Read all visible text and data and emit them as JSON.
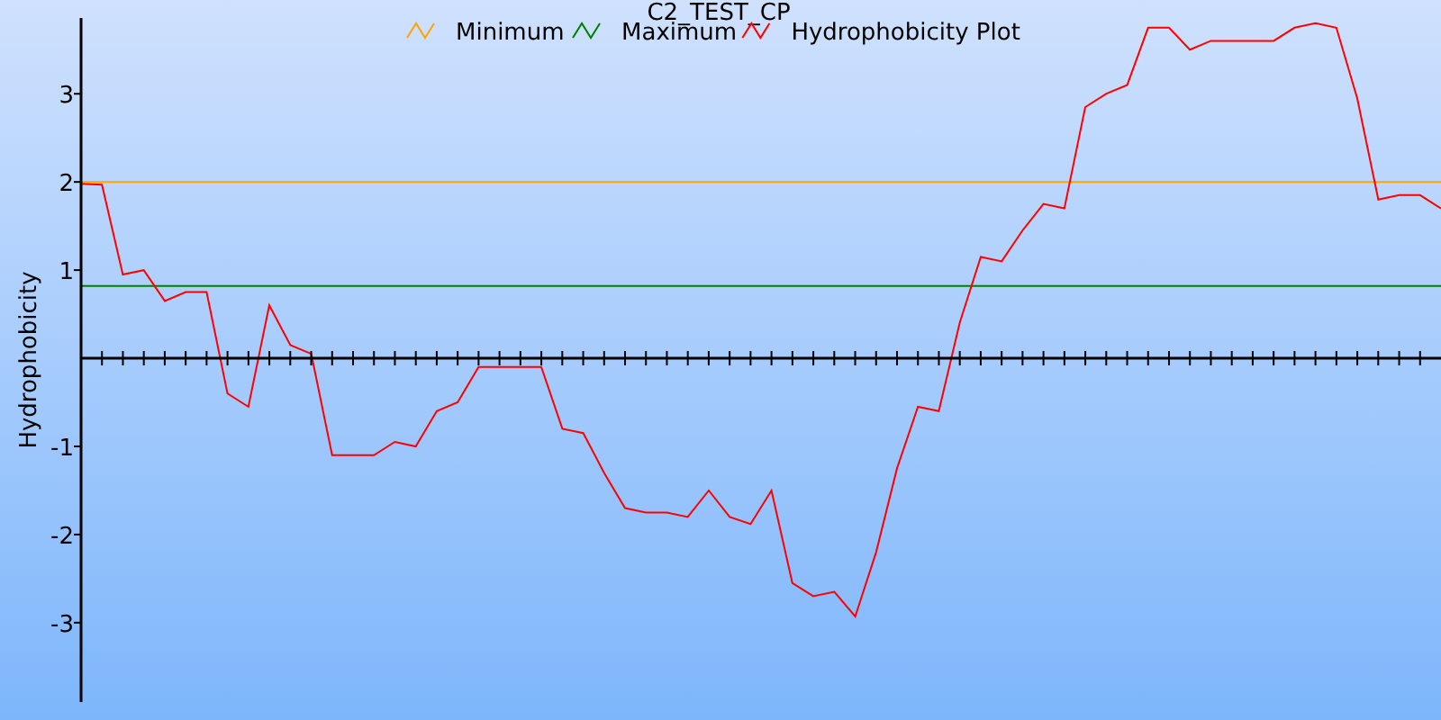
{
  "chart_data": {
    "type": "line",
    "title": "C2_TEST_CP",
    "ylabel": "Hydrophobicity",
    "ylim": [
      -3.9,
      3.86
    ],
    "yticks": [
      -3,
      -2,
      -1,
      1,
      2,
      3
    ],
    "legend": true,
    "categories": [
      null,
      null,
      null,
      null,
      null,
      null,
      null,
      null,
      null,
      null,
      null,
      null,
      null,
      null,
      null,
      null,
      null,
      null,
      null,
      null,
      null,
      null,
      null,
      null,
      null,
      null,
      null,
      null,
      null,
      null,
      null,
      null,
      null,
      null,
      null,
      null,
      null,
      null,
      null,
      null,
      null,
      null,
      null,
      null,
      null,
      null,
      null,
      null,
      null,
      null,
      null,
      null,
      null,
      null,
      null,
      null,
      null,
      null,
      null,
      null,
      null,
      null,
      null,
      null,
      null,
      null
    ],
    "series": [
      {
        "name": "Minimum",
        "color": "#ffa500",
        "values": [
          2,
          2,
          2,
          2,
          2,
          2,
          2,
          2,
          2,
          2,
          2,
          2,
          2,
          2,
          2,
          2,
          2,
          2,
          2,
          2,
          2,
          2,
          2,
          2,
          2,
          2,
          2,
          2,
          2,
          2,
          2,
          2,
          2,
          2,
          2,
          2,
          2,
          2,
          2,
          2,
          2,
          2,
          2,
          2,
          2,
          2,
          2,
          2,
          2,
          2,
          2,
          2,
          2,
          2,
          2,
          2,
          2,
          2,
          2,
          2,
          2,
          2,
          2,
          2,
          2,
          2
        ]
      },
      {
        "name": "Maximum",
        "color": "#008000",
        "values": [
          0.82,
          0.82,
          0.82,
          0.82,
          0.82,
          0.82,
          0.82,
          0.82,
          0.82,
          0.82,
          0.82,
          0.82,
          0.82,
          0.82,
          0.82,
          0.82,
          0.82,
          0.82,
          0.82,
          0.82,
          0.82,
          0.82,
          0.82,
          0.82,
          0.82,
          0.82,
          0.82,
          0.82,
          0.82,
          0.82,
          0.82,
          0.82,
          0.82,
          0.82,
          0.82,
          0.82,
          0.82,
          0.82,
          0.82,
          0.82,
          0.82,
          0.82,
          0.82,
          0.82,
          0.82,
          0.82,
          0.82,
          0.82,
          0.82,
          0.82,
          0.82,
          0.82,
          0.82,
          0.82,
          0.82,
          0.82,
          0.82,
          0.82,
          0.82,
          0.82,
          0.82,
          0.82,
          0.82,
          0.82,
          0.82,
          0.82
        ]
      },
      {
        "name": "Hydrophobicity Plot",
        "color": "#ff0000",
        "values": [
          1.98,
          1.97,
          0.95,
          1.0,
          0.65,
          0.75,
          0.75,
          -0.4,
          -0.55,
          0.6,
          0.15,
          0.05,
          -1.1,
          -1.1,
          -1.1,
          -0.95,
          -1.0,
          -0.6,
          -0.5,
          -0.1,
          -0.1,
          -0.1,
          -0.1,
          -0.8,
          -0.85,
          -1.3,
          -1.7,
          -1.75,
          -1.75,
          -1.8,
          -1.5,
          -1.8,
          -1.88,
          -1.5,
          -2.55,
          -2.7,
          -2.65,
          -2.93,
          -2.2,
          -1.25,
          -0.55,
          -0.6,
          0.4,
          1.15,
          1.1,
          1.45,
          1.75,
          1.7,
          2.85,
          3.0,
          3.1,
          3.75,
          3.75,
          3.5,
          3.6,
          3.6,
          3.6,
          3.6,
          3.75,
          3.8,
          3.75,
          2.95,
          1.8,
          1.85,
          1.85,
          1.7
        ]
      }
    ]
  }
}
